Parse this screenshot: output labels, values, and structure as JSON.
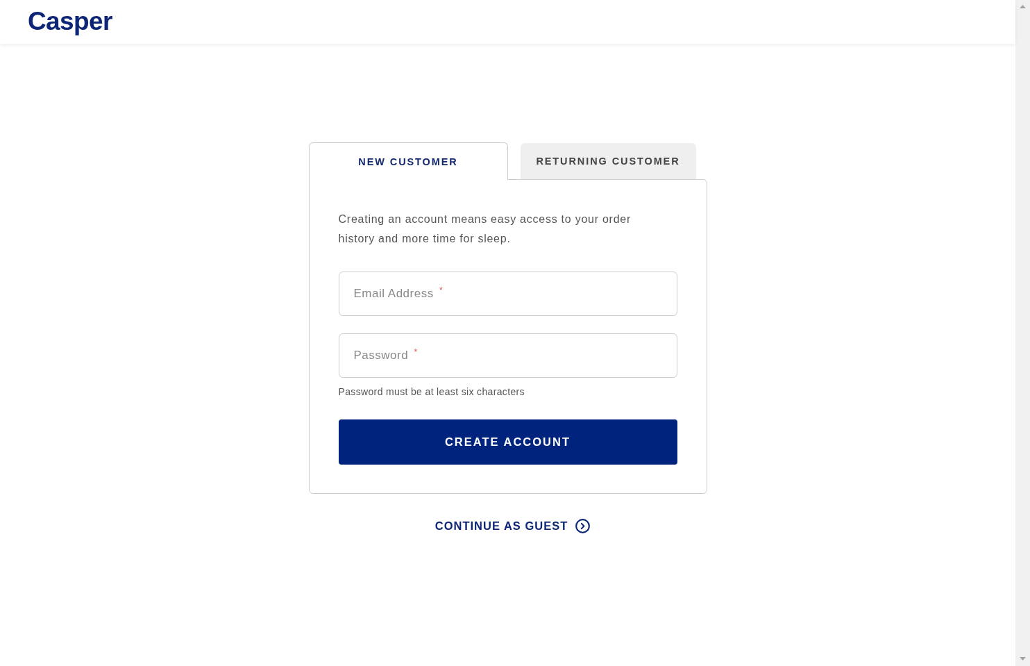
{
  "header": {
    "logo": "Casper"
  },
  "tabs": [
    {
      "label": "NEW CUSTOMER",
      "selected": true
    },
    {
      "label": "RETURNING CUSTOMER",
      "selected": false
    }
  ],
  "form": {
    "description": "Creating an account means easy access to your order history and more time for sleep.",
    "fields": [
      {
        "placeholder": "Email Address $^{*}$"
      },
      {
        "placeholder": "Password $^{*}$",
        "hint": "Password must be at least six characters"
      }
    ],
    "submit": "CREATE ACCOUNT"
  },
  "guest_link": "CONTINUE AS GUEST"
}
